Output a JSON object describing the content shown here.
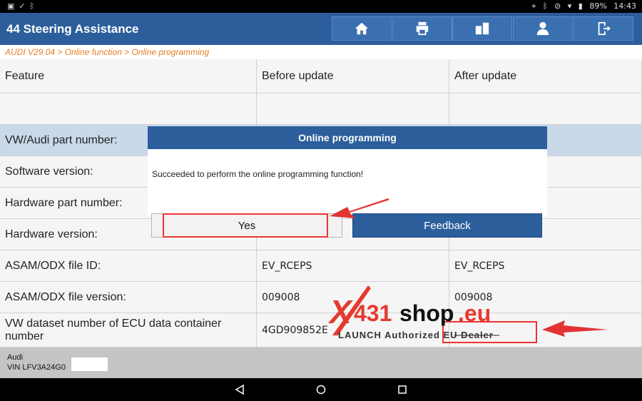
{
  "status_bar": {
    "left_icons": [
      "image-icon",
      "check-icon",
      "bluetooth-icon"
    ],
    "battery": "89%",
    "time": "14:43"
  },
  "header": {
    "title": "44 Steering Assistance",
    "buttons": [
      "home-icon",
      "print-icon",
      "report-icon",
      "user-icon",
      "exit-icon"
    ]
  },
  "breadcrumb": "AUDI V29.04 > Online function > Online programming",
  "table": {
    "headers": [
      "Feature",
      "Before update",
      "After update"
    ],
    "rows": [
      {
        "feature": "",
        "before": "",
        "after": ""
      },
      {
        "feature": "VW/Audi part number:",
        "before": "",
        "after": ""
      },
      {
        "feature": "Software version:",
        "before": "",
        "after": ""
      },
      {
        "feature": "Hardware part number:",
        "before": "",
        "after": ""
      },
      {
        "feature": "Hardware version:",
        "before": "",
        "after": ""
      },
      {
        "feature": "ASAM/ODX file ID:",
        "before": "EV_RCEPS",
        "after": "EV_RCEPS"
      },
      {
        "feature": "ASAM/ODX file version:",
        "before": "009008",
        "after": "009008"
      },
      {
        "feature": "VW dataset number of ECU data container number",
        "before": "4GD909852E",
        "after": "_________"
      }
    ]
  },
  "footer": {
    "make": "Audi",
    "vin": "VIN LFV3A24G0"
  },
  "dialog": {
    "title": "Online programming",
    "message": "Succeeded to perform the online programming function!",
    "yes_label": "Yes",
    "feedback_label": "Feedback"
  },
  "watermark": {
    "x": "X",
    "num": "431",
    "shop": "shop",
    "eu": ".eu",
    "tagline": "LAUNCH Authorized EU Dealer"
  },
  "colors": {
    "header_bg": "#2c5e9c",
    "breadcrumb": "#e67e22",
    "annotation_red": "#e33333"
  }
}
